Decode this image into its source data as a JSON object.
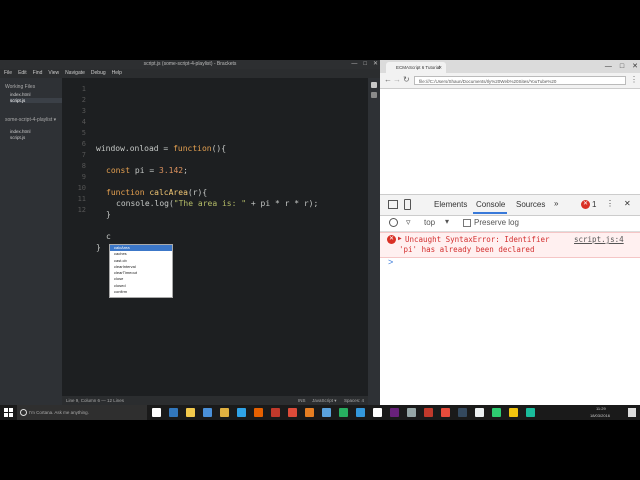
{
  "brackets": {
    "title": "script.js (some-script-4-playlist) - Brackets",
    "menu": [
      "File",
      "Edit",
      "Find",
      "View",
      "Navigate",
      "Debug",
      "Help"
    ],
    "sidebar": {
      "working_files_label": "Working Files",
      "working_files": [
        "index.html",
        "script.js"
      ],
      "project_label": "some-script-4-playlist ▾",
      "project_files": [
        "index.html",
        "script.js"
      ]
    },
    "line_numbers": [
      "1",
      "2",
      "3",
      "4",
      "5",
      "6",
      "7",
      "8",
      "9",
      "10",
      "11",
      "12"
    ],
    "code": {
      "l1_a": "window.onload = ",
      "l1_kw": "function",
      "l1_b": "(){",
      "l3_kw": "const",
      "l3_a": " pi = ",
      "l3_num": "3.142",
      "l3_b": ";",
      "l5_kw": "function",
      "l5_fn": " calcArea",
      "l5_a": "(r){",
      "l6_a": "console.log(",
      "l6_str": "\"The area is: \"",
      "l6_b": " + pi * r * r);",
      "l7": "}",
      "l9": "c",
      "l10": "}"
    },
    "autocomplete": [
      "calcArea",
      "caches",
      "cast.cb",
      "clearInterval",
      "clearTimeout",
      "close",
      "closed",
      "confirm"
    ],
    "status": {
      "left": "Line 9, Column 6 — 12 Lines",
      "ins": "INS",
      "lang": "JavaScript ▾",
      "indent": "Spaces: 4"
    }
  },
  "chrome": {
    "tab_title": "ECMAScript 6 Tutorial",
    "url": "file:///C:/Users/Shaun/Documents/Ily%20Web%20Sites/YouTube%20",
    "devtools": {
      "tabs": [
        "Elements",
        "Console",
        "Sources"
      ],
      "more": "»",
      "error_count": "1",
      "context": "top",
      "preserve_log": "Preserve log",
      "error_line1": "Uncaught SyntaxError: Identifier",
      "error_line2": "'pi' has already been declared",
      "error_source": "script.js:4",
      "prompt": ">"
    }
  },
  "taskbar": {
    "search_placeholder": "I'm Cortana. Ask me anything.",
    "time": "11:29",
    "date": "18/03/2016",
    "app_icons": [
      {
        "name": "task-view-icon",
        "color": "#ffffff"
      },
      {
        "name": "edge-icon",
        "color": "#3277bc"
      },
      {
        "name": "file-explorer-icon",
        "color": "#f2c94c"
      },
      {
        "name": "store-icon",
        "color": "#4a90d9"
      },
      {
        "name": "folder-icon",
        "color": "#e0b040"
      },
      {
        "name": "photoshop-icon",
        "color": "#2fa3e7"
      },
      {
        "name": "firefox-icon",
        "color": "#e66000"
      },
      {
        "name": "app-icon",
        "color": "#c0392b"
      },
      {
        "name": "chrome-icon",
        "color": "#dd4b39"
      },
      {
        "name": "illustrator-icon",
        "color": "#e67e22"
      },
      {
        "name": "brackets-icon",
        "color": "#5aa2dd"
      },
      {
        "name": "app-icon-2",
        "color": "#27ae60"
      },
      {
        "name": "app-icon-3",
        "color": "#3498db"
      },
      {
        "name": "app-icon-4",
        "color": "#ffffff"
      },
      {
        "name": "visual-studio-icon",
        "color": "#68217a"
      },
      {
        "name": "app-icon-5",
        "color": "#95a5a6"
      },
      {
        "name": "app-icon-6",
        "color": "#c0392b"
      },
      {
        "name": "app-icon-7",
        "color": "#e74c3c"
      },
      {
        "name": "app-icon-8",
        "color": "#34495e"
      },
      {
        "name": "app-icon-9",
        "color": "#ecf0f1"
      },
      {
        "name": "app-icon-10",
        "color": "#2ecc71"
      },
      {
        "name": "app-icon-11",
        "color": "#f1c40f"
      },
      {
        "name": "app-icon-12",
        "color": "#1abc9c"
      }
    ]
  }
}
